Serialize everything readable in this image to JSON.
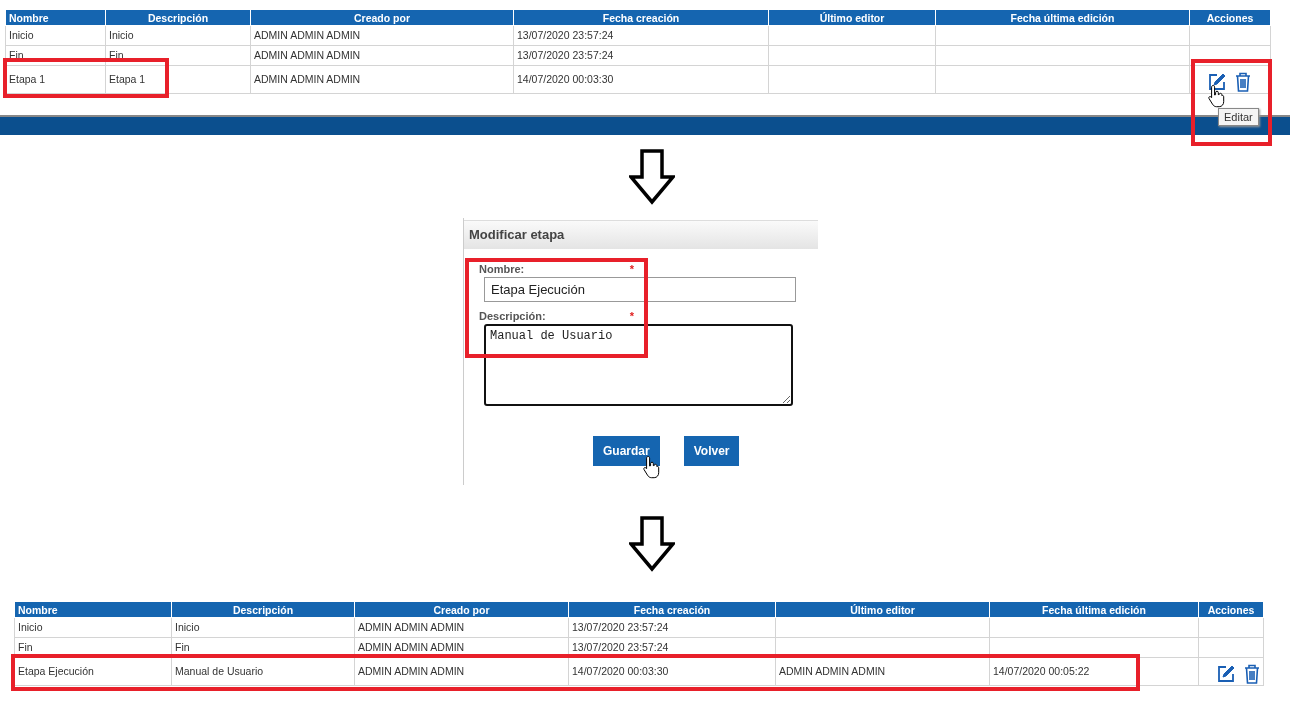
{
  "top_table": {
    "columns": [
      "Nombre",
      "Descripción",
      "Creado por",
      "Fecha creación",
      "Último editor",
      "Fecha última edición",
      "Acciones"
    ],
    "rows": [
      {
        "name": "Inicio",
        "description": "Inicio",
        "created_by": "ADMIN ADMIN ADMIN",
        "created_at": "13/07/2020 23:57:24",
        "actions": false
      },
      {
        "name": "Fin",
        "description": "Fin",
        "created_by": "ADMIN ADMIN ADMIN",
        "created_at": "13/07/2020 23:57:24",
        "actions": false
      },
      {
        "name": "Etapa 1",
        "description": "Etapa 1",
        "created_by": "ADMIN ADMIN ADMIN",
        "created_at": "14/07/2020 00:03:30",
        "actions": true
      }
    ],
    "tooltip": "Editar"
  },
  "dialog": {
    "title": "Modificar etapa",
    "fields": [
      {
        "kind": "input",
        "label": "Nombre:",
        "required_mark": "*",
        "value": "Etapa Ejecución"
      },
      {
        "kind": "textarea",
        "label": "Descripción:",
        "required_mark": "*",
        "value": "Manual de Usuario"
      }
    ],
    "buttons": [
      "Guardar",
      "Volver"
    ]
  },
  "bottom_table": {
    "columns": [
      "Nombre",
      "Descripción",
      "Creado por",
      "Fecha creación",
      "Último editor",
      "Fecha última edición",
      "Acciones"
    ],
    "rows": [
      {
        "name": "Inicio",
        "description": "Inicio",
        "created_by": "ADMIN ADMIN ADMIN",
        "created_at": "13/07/2020 23:57:24",
        "actions": false
      },
      {
        "name": "Fin",
        "description": "Fin",
        "created_by": "ADMIN ADMIN ADMIN",
        "created_at": "13/07/2020 23:57:24",
        "actions": false
      },
      {
        "name": "Etapa Ejecución",
        "description": "Manual de Usuario",
        "created_by": "ADMIN ADMIN ADMIN",
        "created_at": "14/07/2020 00:03:30",
        "last_editor": "ADMIN ADMIN ADMIN",
        "last_edited_at": "14/07/2020 00:05:22",
        "actions": true
      }
    ]
  }
}
